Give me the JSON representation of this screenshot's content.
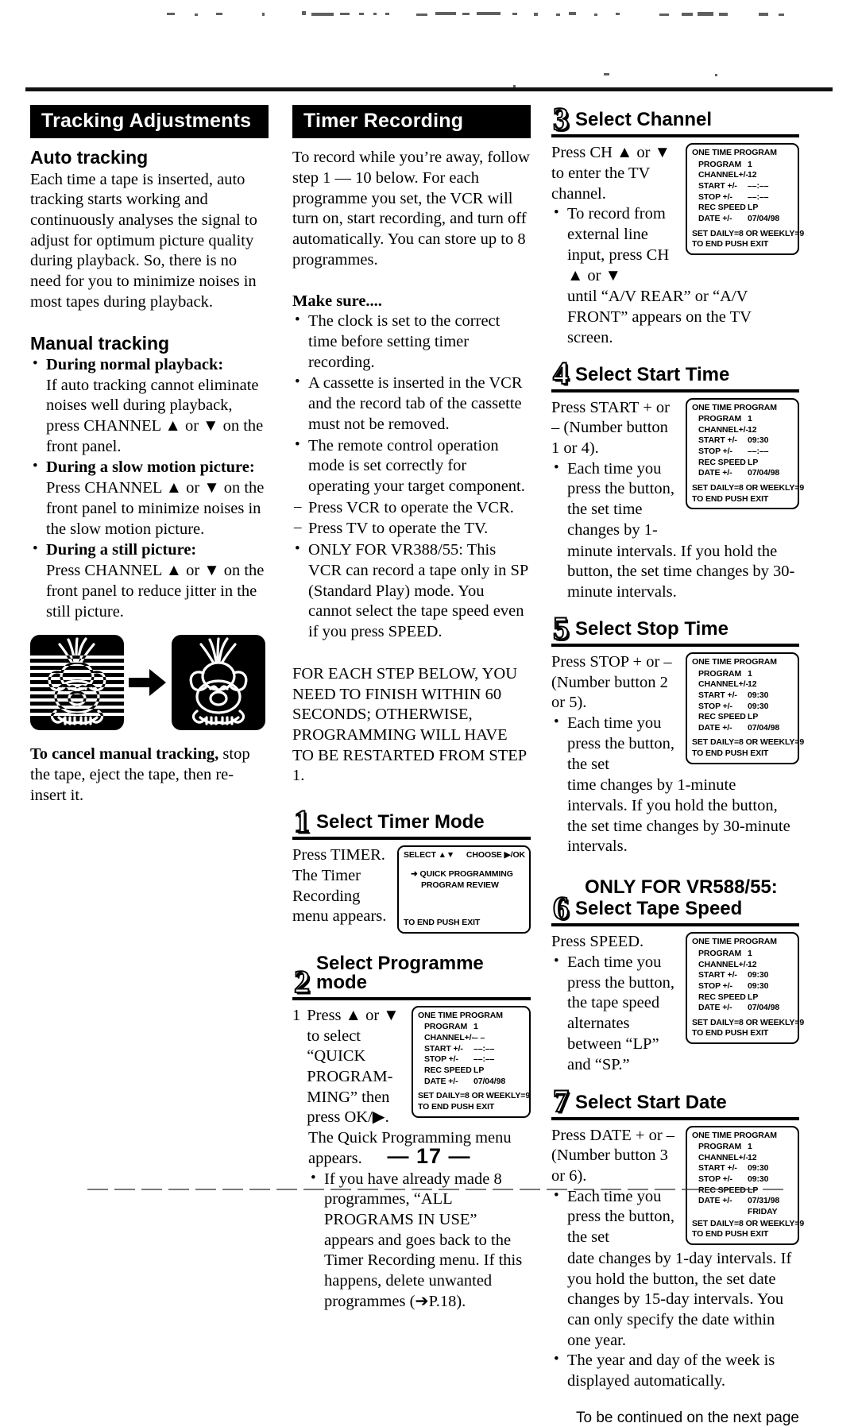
{
  "page": {
    "number": "— 17 —"
  },
  "left_column": {
    "banner": "Tracking Adjustments",
    "auto": {
      "heading": "Auto tracking",
      "body": "Each time a tape is inserted, auto tracking starts working and continuously analyses the signal to adjust for optimum picture quality during playback. So, there is no need for you to minimize noises in most tapes during playback."
    },
    "manual": {
      "heading": "Manual tracking",
      "items": [
        {
          "label": "During normal playback:",
          "text": "If auto tracking cannot eliminate noises well during playback, press CHANNEL ▲ or ▼ on the front panel."
        },
        {
          "label": "During a slow motion picture:",
          "text": "Press CHANNEL ▲ or ▼ on the front panel to minimize noises in the slow motion picture."
        },
        {
          "label": "During a still picture:",
          "text": "Press CHANNEL ▲ or ▼ on the front panel to reduce jitter in the still picture."
        }
      ]
    },
    "illustration": {
      "left_caption": "noisy-picture",
      "right_caption": "clean-picture",
      "arrow": "right-arrow"
    },
    "cancel": {
      "bold": "To cancel manual tracking,",
      "rest": " stop the tape, eject the tape, then re-insert it."
    }
  },
  "middle_column": {
    "banner": "Timer Recording",
    "intro": "To record while you’re away, follow step 1 — 10 below.  For each programme you set, the VCR will turn on, start recording, and turn off automatically. You can store up to 8 programmes.",
    "make_sure": {
      "heading": "Make sure....",
      "items": [
        "The clock is set to the correct time before setting timer recording.",
        "A cassette is inserted in the VCR and the record tab of the cassette must not be removed.",
        "The remote control operation mode is set correctly for operating your target component."
      ],
      "dashes": [
        "Press VCR to operate the VCR.",
        "Press TV to operate the TV."
      ],
      "last_item": "ONLY FOR VR388/55: This VCR can record a tape only in SP (Standard Play) mode. You cannot select the tape speed even if you press SPEED."
    },
    "warning": "FOR EACH STEP BELOW, YOU NEED TO FINISH WITHIN 60 SECONDS; OTHERWISE, PROGRAMMING WILL HAVE TO BE RESTARTED FROM STEP 1.",
    "step1": {
      "num": "1",
      "title": "Select Timer Mode",
      "text": "Press TIMER. The Timer Recording menu appears.",
      "osd": {
        "head_left": "SELECT ▲▼",
        "head_right": "CHOOSE ▶/OK",
        "item1": "QUICK PROGRAMMING",
        "item2": "PROGRAM  REVIEW",
        "foot": "TO END PUSH EXIT"
      }
    },
    "step2": {
      "num": "2",
      "title": "Select Programme mode",
      "item_no": "1",
      "text": "Press ▲ or ▼ to select “QUICK PROGRAM-MING” then press OK/▶.",
      "after": "The Quick Programming menu appears.",
      "bullet": "If you have already made 8 programmes, “ALL PROGRAMS IN USE” appears and goes back to the Timer Recording menu. If this happens, delete unwanted programmes (➔P.18).",
      "osd": {
        "title": "ONE TIME PROGRAM",
        "rows": [
          {
            "label": "PROGRAM",
            "value": "1"
          },
          {
            "label": "CHANNEL+/-",
            "value": "– –"
          },
          {
            "label": "START +/-",
            "value": "––:––"
          },
          {
            "label": "STOP +/-",
            "value": "––:––"
          },
          {
            "label": "REC SPEED",
            "value": "LP"
          },
          {
            "label": "DATE +/-",
            "value": "07/04/98"
          }
        ],
        "foot1": "SET DAILY=8 OR WEEKLY=9",
        "foot2": "TO END PUSH EXIT"
      }
    }
  },
  "right_column": {
    "step3": {
      "num": "3",
      "title": "Select Channel",
      "text": "Press CH ▲ or ▼ to enter the TV channel.",
      "bullet": "To record from external line input, press CH ▲ or ▼",
      "bullet_cont": "until “A/V REAR” or “A/V FRONT” appears on the TV screen.",
      "osd": {
        "title": "ONE TIME PROGRAM",
        "rows": [
          {
            "label": "PROGRAM",
            "value": "1"
          },
          {
            "label": "CHANNEL+/-",
            "value": "12"
          },
          {
            "label": "START +/-",
            "value": "––:––"
          },
          {
            "label": "STOP +/-",
            "value": "––:––"
          },
          {
            "label": "REC SPEED",
            "value": "LP"
          },
          {
            "label": "DATE +/-",
            "value": "07/04/98"
          }
        ],
        "foot1": "SET DAILY=8 OR WEEKLY=9",
        "foot2": "TO END PUSH EXIT"
      }
    },
    "step4": {
      "num": "4",
      "title": "Select Start Time",
      "text": "Press START + or – (Number button 1 or 4).",
      "bullet": "Each time you press the button, the set time changes by 1-",
      "bullet_cont": "minute intervals. If you hold the button, the set time changes by 30-minute intervals.",
      "osd": {
        "title": "ONE TIME PROGRAM",
        "rows": [
          {
            "label": "PROGRAM",
            "value": "1"
          },
          {
            "label": "CHANNEL+/-",
            "value": "12"
          },
          {
            "label": "START +/-",
            "value": "09:30"
          },
          {
            "label": "STOP +/-",
            "value": "––:––"
          },
          {
            "label": "REC SPEED",
            "value": "LP"
          },
          {
            "label": "DATE +/-",
            "value": "07/04/98"
          }
        ],
        "foot1": "SET DAILY=8 OR WEEKLY=9",
        "foot2": "TO END PUSH EXIT"
      }
    },
    "step5": {
      "num": "5",
      "title": "Select Stop Time",
      "text": "Press STOP + or – (Number button 2 or 5).",
      "bullet": "Each time you press the button, the set",
      "bullet_cont": "time changes by 1-minute intervals. If you hold the button, the set time changes by 30-minute intervals.",
      "osd": {
        "title": "ONE TIME PROGRAM",
        "rows": [
          {
            "label": "PROGRAM",
            "value": "1"
          },
          {
            "label": "CHANNEL+/-",
            "value": "12"
          },
          {
            "label": "START +/-",
            "value": "09:30"
          },
          {
            "label": "STOP +/-",
            "value": "09:30"
          },
          {
            "label": "REC SPEED",
            "value": "LP"
          },
          {
            "label": "DATE +/-",
            "value": "07/04/98"
          }
        ],
        "foot1": "SET DAILY=8 OR WEEKLY=9",
        "foot2": "TO END PUSH EXIT"
      }
    },
    "step6": {
      "num": "6",
      "pretitle": "ONLY FOR VR588/55:",
      "title": "Select Tape Speed",
      "text": "Press SPEED.",
      "bullet": "Each time you press the button, the tape speed alternates between “LP” and “SP.”",
      "osd": {
        "title": "ONE TIME PROGRAM",
        "rows": [
          {
            "label": "PROGRAM",
            "value": "1"
          },
          {
            "label": "CHANNEL+/-",
            "value": "12"
          },
          {
            "label": "START +/-",
            "value": "09:30"
          },
          {
            "label": "STOP +/-",
            "value": "09:30"
          },
          {
            "label": "REC SPEED",
            "value": "LP"
          },
          {
            "label": "DATE +/-",
            "value": "07/04/98"
          }
        ],
        "foot1": "SET DAILY=8 OR WEEKLY=9",
        "foot2": "TO END PUSH EXIT"
      }
    },
    "step7": {
      "num": "7",
      "title": "Select Start Date",
      "text": "Press DATE + or – (Number button 3 or 6).",
      "bullet": "Each time you press the button, the set",
      "bullet_cont": "date changes by 1-day intervals. If you hold the button, the set date changes by 15-day intervals. You can only specify the date within one year.",
      "bullet2": "The year and day of the week is displayed automatically.",
      "osd": {
        "title": "ONE TIME PROGRAM",
        "rows": [
          {
            "label": "PROGRAM",
            "value": "1"
          },
          {
            "label": "CHANNEL+/-",
            "value": "12"
          },
          {
            "label": "START +/-",
            "value": "09:30"
          },
          {
            "label": "STOP +/-",
            "value": "09:30"
          },
          {
            "label": "REC SPEED",
            "value": "LP"
          },
          {
            "label": "DATE +/-",
            "value": "07/31/98"
          }
        ],
        "day_of_week": "FRIDAY",
        "foot1": "SET DAILY=8 OR WEEKLY=9",
        "foot2": "TO END PUSH EXIT"
      }
    },
    "continued": "To be continued on the next page"
  }
}
